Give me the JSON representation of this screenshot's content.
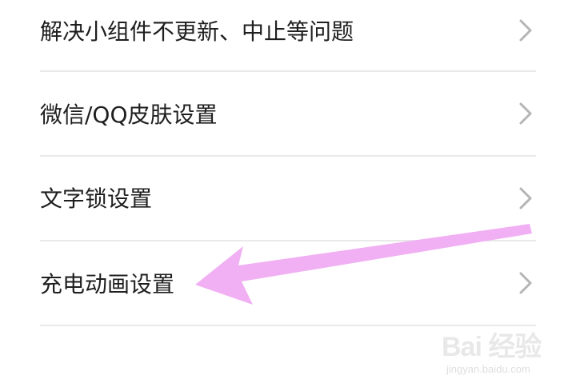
{
  "settings": {
    "items": [
      {
        "label": "解决小组件不更新、中止等问题",
        "icon": "chevron-right-icon"
      },
      {
        "label": "微信/QQ皮肤设置",
        "icon": "chevron-right-icon"
      },
      {
        "label": "文字锁设置",
        "icon": "chevron-right-icon"
      },
      {
        "label": "充电动画设置",
        "icon": "chevron-right-icon"
      }
    ]
  },
  "annotation": {
    "arrow_color": "#f1b0f3",
    "points_to": "充电动画设置"
  },
  "watermark": {
    "logo_text": "Bai 经验",
    "url": "jingyan.baidu.com"
  },
  "colors": {
    "text": "#1f1f1f",
    "divider": "#e9e9e9",
    "chevron": "#b5b5b5",
    "background": "#ffffff"
  }
}
